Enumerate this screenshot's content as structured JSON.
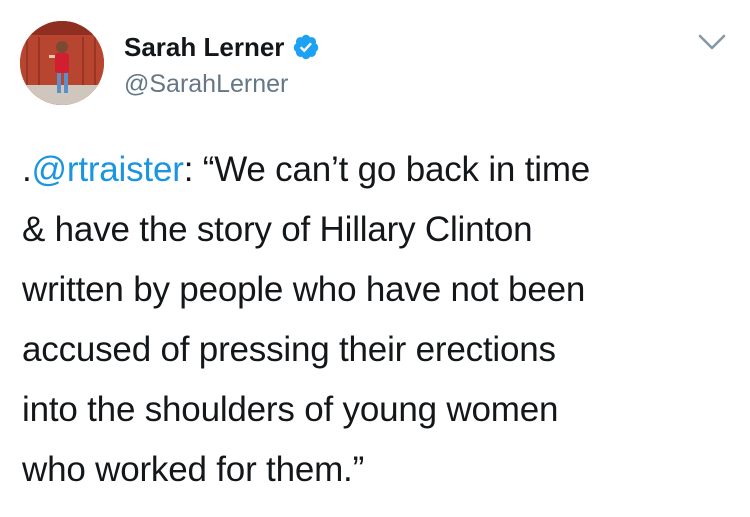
{
  "author": {
    "display_name": "Sarah Lerner",
    "handle": "@SarahLerner",
    "verified": true
  },
  "tweet": {
    "prefix": ".",
    "mention": "@rtraister",
    "line1_rest": ": “We can’t go back in time",
    "lines": [
      "& have the story of Hillary Clinton",
      "written by people who have not been",
      "accused of pressing their erections",
      "into the shoulders of young women",
      "who worked for them.”"
    ]
  },
  "icons": {
    "verified": "verified-badge-icon",
    "menu": "chevron-down-icon"
  },
  "colors": {
    "link": "#1b95e0",
    "text": "#14171a",
    "secondary": "#657786",
    "verified": "#1da1f2"
  }
}
